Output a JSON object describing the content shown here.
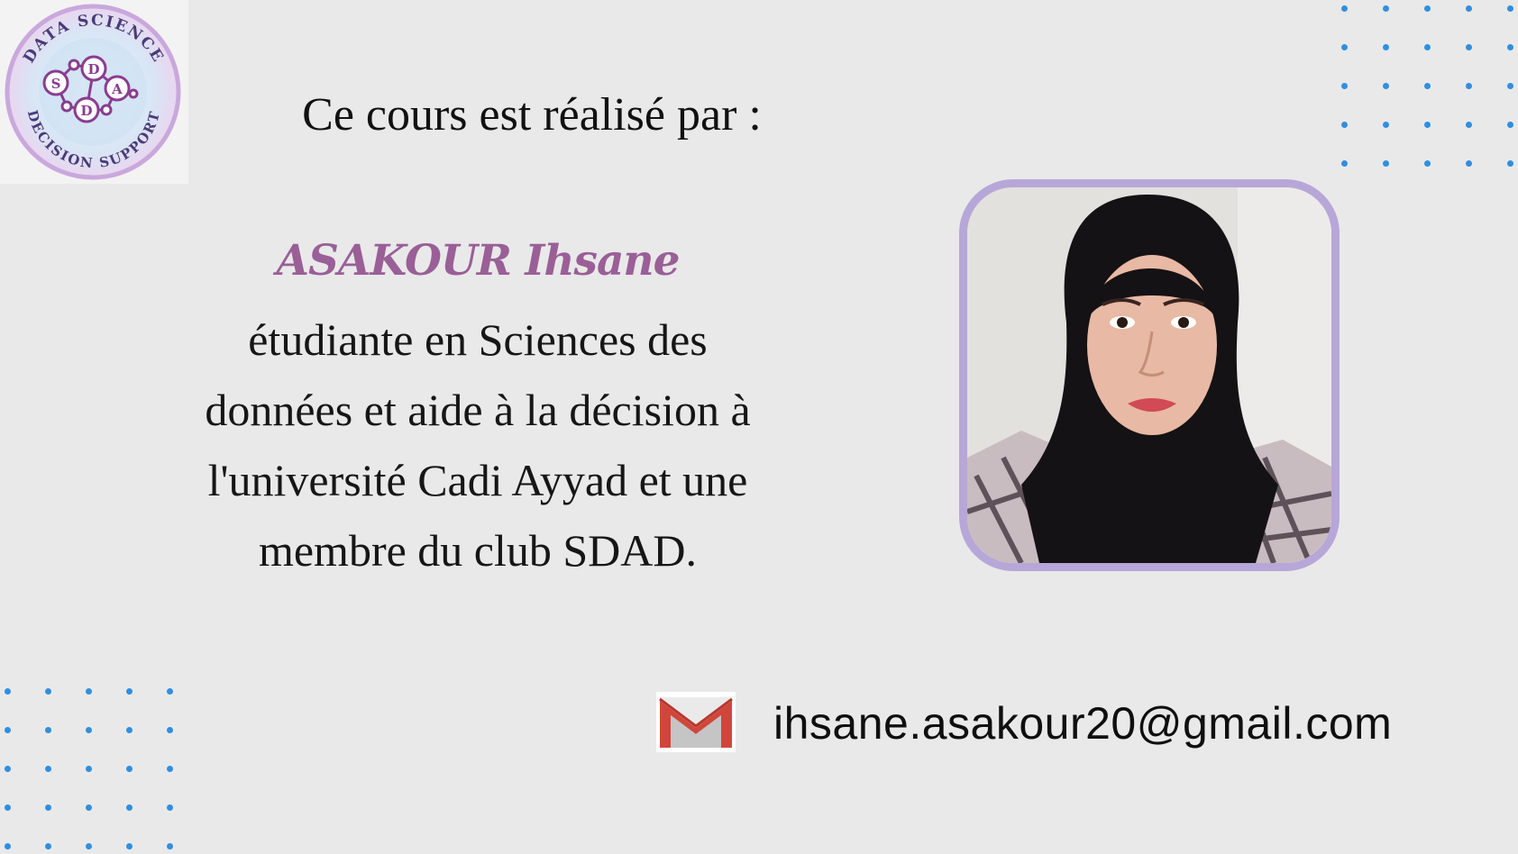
{
  "logo": {
    "top_text": "DATA SCIENCE",
    "bottom_text": "DECISION SUPPORT",
    "letters": [
      "S",
      "D",
      "A",
      "D"
    ]
  },
  "headline": "Ce cours est réalisé par :",
  "author": {
    "name": "ASAKOUR Ihsane",
    "description_lines": [
      "étudiante en Sciences des",
      "données et aide à la décision à",
      "l'université Cadi Ayyad et une",
      "membre du club SDAD."
    ]
  },
  "contact": {
    "icon": "gmail-icon",
    "email": "ihsane.asakour20@gmail.com"
  },
  "colors": {
    "background": "#e9e9e9",
    "name": "#9a5f97",
    "photo_border": "#b7a7d8",
    "dots": "#2f8fe0"
  }
}
